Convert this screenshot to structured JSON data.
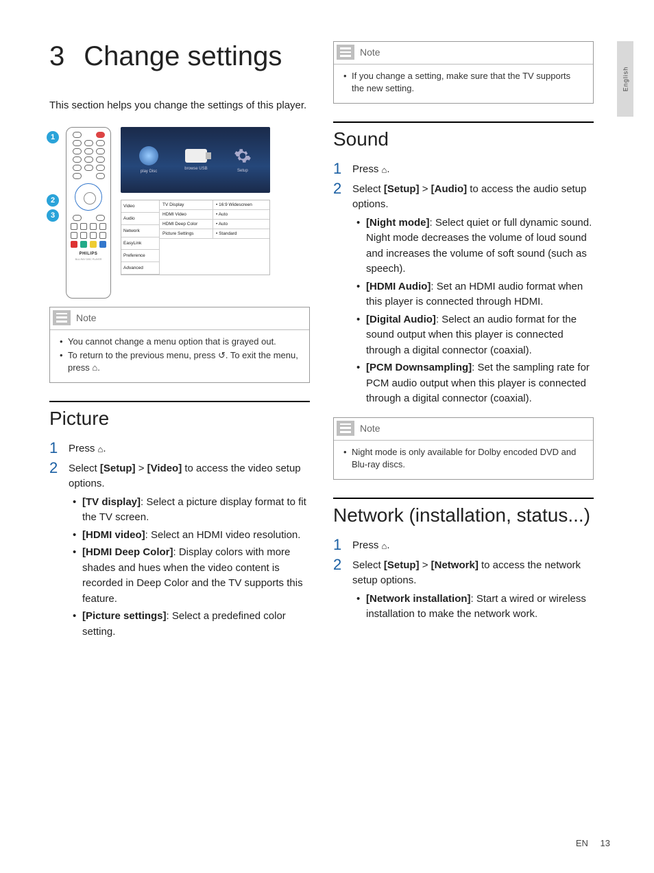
{
  "lang_tab": "English",
  "chapter": {
    "num": "3",
    "title": "Change settings"
  },
  "intro": "This section helps you change the settings of this player.",
  "callouts": [
    "1",
    "2",
    "3"
  ],
  "diagram": {
    "remote_logo": "PHILIPS",
    "remote_sub": "BLU-RAY DISC PLAYER",
    "screen1": {
      "playdisc": "play Disc",
      "browse": "browse USB",
      "setup": "Setup"
    },
    "menu": [
      "Video",
      "Audio",
      "Network",
      "EasyLink",
      "Preference",
      "Advanced"
    ],
    "rows": [
      {
        "k": "TV Display",
        "v": "• 16:9 Widescreen"
      },
      {
        "k": "HDMI Video",
        "v": "• Auto"
      },
      {
        "k": "HDMI Deep Color",
        "v": "• Auto"
      },
      {
        "k": "Picture Settings",
        "v": "• Standard"
      }
    ]
  },
  "note1": {
    "label": "Note",
    "items": [
      "You cannot change a menu option that is grayed out.",
      "To return to the previous menu, press ↺. To exit the menu, press ⌂."
    ]
  },
  "picture": {
    "heading": "Picture",
    "step1_pre": "Press ",
    "step1_post": ".",
    "step2_pre": "Select ",
    "step2_b1": "[Setup]",
    "step2_mid": " > ",
    "step2_b2": "[Video]",
    "step2_post": " to access the video setup options.",
    "opts": [
      {
        "label": "[TV display]",
        "text": ": Select a picture display format to fit the TV screen."
      },
      {
        "label": "[HDMI video]",
        "text": ": Select an HDMI video resolution."
      },
      {
        "label": "[HDMI Deep Color]",
        "text": ": Display colors with more shades and hues when the video content is recorded in Deep Color and the TV supports this feature."
      },
      {
        "label": "[Picture settings]",
        "text": ": Select a predefined color setting."
      }
    ]
  },
  "note_top_right": {
    "label": "Note",
    "items": [
      "If you change a setting, make sure that the TV supports the new setting."
    ]
  },
  "sound": {
    "heading": "Sound",
    "step1_pre": "Press ",
    "step1_post": ".",
    "step2_pre": "Select ",
    "step2_b1": "[Setup]",
    "step2_mid": " > ",
    "step2_b2": "[Audio]",
    "step2_post": " to access the audio setup options.",
    "opts": [
      {
        "label": "[Night mode]",
        "text": ": Select quiet or full dynamic sound. Night mode decreases the volume of loud sound and increases the volume of soft sound (such as speech)."
      },
      {
        "label": "[HDMI Audio]",
        "text": ": Set an HDMI audio format when this player is connected through HDMI."
      },
      {
        "label": "[Digital Audio]",
        "text": ": Select an audio format for the sound output when this player is connected through a digital connector (coaxial)."
      },
      {
        "label": "[PCM Downsampling]",
        "text": ": Set the sampling rate for PCM audio output when this player is connected through a digital connector (coaxial)."
      }
    ]
  },
  "note_sound": {
    "label": "Note",
    "items": [
      "Night mode is only available for Dolby encoded DVD and Blu-ray discs."
    ]
  },
  "network": {
    "heading": "Network (installation, status...)",
    "step1_pre": "Press ",
    "step1_post": ".",
    "step2_pre": "Select ",
    "step2_b1": "[Setup]",
    "step2_mid": " > ",
    "step2_b2": "[Network]",
    "step2_post": " to access the network setup options.",
    "opts": [
      {
        "label": "[Network installation]",
        "text": ": Start a wired or wireless installation to make the network work."
      }
    ]
  },
  "footer": {
    "lang": "EN",
    "page": "13"
  }
}
